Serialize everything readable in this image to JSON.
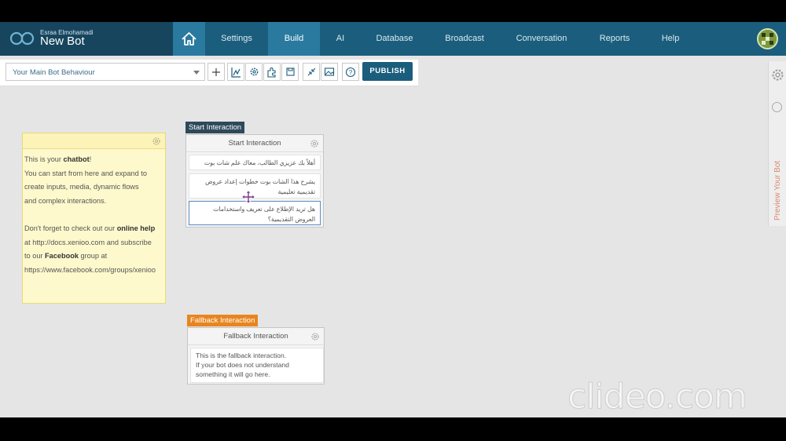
{
  "brand": {
    "user": "Esraa Elmohamadi",
    "bot_name": "New Bot"
  },
  "nav": {
    "items": [
      "Settings",
      "Build",
      "AI",
      "Database",
      "Broadcast",
      "Conversation",
      "Reports",
      "Help"
    ],
    "active": "Build"
  },
  "toolbar": {
    "behaviour": "Your Main Bot Behaviour",
    "publish": "PUBLISH"
  },
  "right_panel": {
    "preview": "Preview Your Bot"
  },
  "note": {
    "l1a": "This is your ",
    "l1b": "chatbot",
    "l1c": "!",
    "l2": "You can start from here and expand to",
    "l3": "create inputs, media, dynamic flows",
    "l4": "and complex interactions.",
    "l5a": "Don't forget to check out our ",
    "l5b": "online help",
    "l6": "at http://docs.xenioo.com and subscribe",
    "l7a": "to our ",
    "l7b": "Facebook",
    "l7c": " group at",
    "l8": "https://www.facebook.com/groups/xenioo"
  },
  "start_interaction": {
    "tag": "Start Interaction",
    "title": "Start Interaction",
    "messages": [
      "أهلاً بك عزيزي الطالب، معاك علم شات بوت",
      "يشرح هذا الشات بوت خطوات إعداد عروض تقديمية تعليمية",
      "هل تريد الإطلاع على تعريف واستخدامات العروض التقديمية؟"
    ]
  },
  "fallback_interaction": {
    "tag": "Fallback Interaction",
    "title": "Fallback Interaction",
    "text1": "This is the fallback interaction.",
    "text2": "If your bot does not understand",
    "text3": "something it will go here."
  },
  "watermark": "clideo.com",
  "colors": {
    "nav": "#1b5d7c",
    "nav_active": "#2a7aa0",
    "start_tag": "#2e4a5a",
    "fallback_tag": "#e8851e",
    "note_bg": "#fdf9cc"
  },
  "icons": [
    "home-icon",
    "plus-icon",
    "chart-icon",
    "gear-icon",
    "puzzle-icon",
    "save-icon",
    "compress-icon",
    "image-icon",
    "help-icon"
  ]
}
